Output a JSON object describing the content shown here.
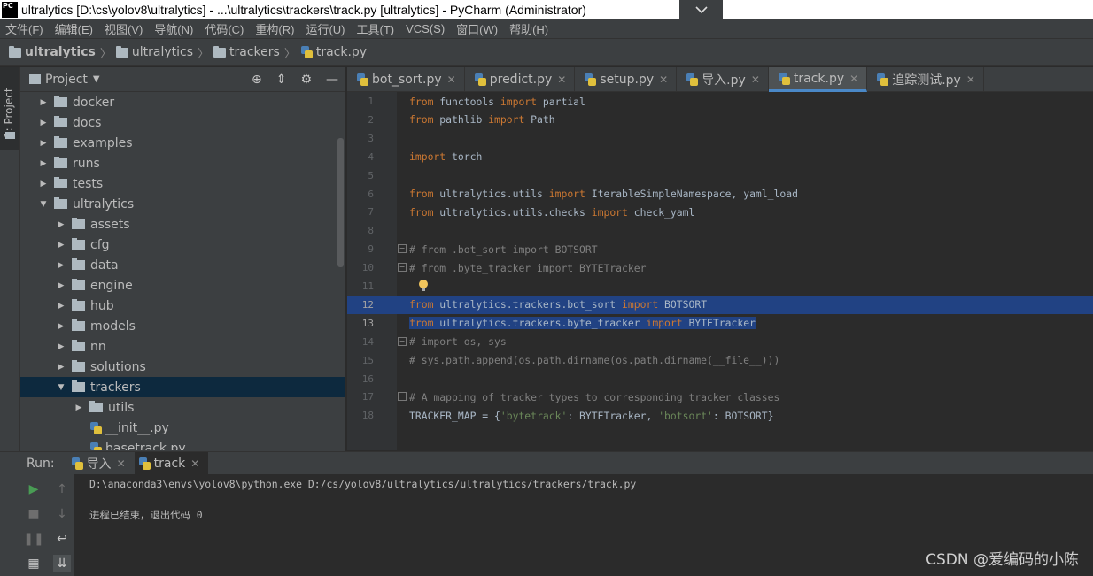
{
  "titlebar": {
    "logo": "PC",
    "title": "ultralytics [D:\\cs\\yolov8\\ultralytics] - ...\\ultralytics\\trackers\\track.py [ultralytics] - PyCharm (Administrator)"
  },
  "menu": [
    "文件(F)",
    "编辑(E)",
    "视图(V)",
    "导航(N)",
    "代码(C)",
    "重构(R)",
    "运行(U)",
    "工具(T)",
    "VCS(S)",
    "窗口(W)",
    "帮助(H)"
  ],
  "breadcrumb": [
    "ultralytics",
    "ultralytics",
    "trackers",
    "track.py"
  ],
  "toolstrip": {
    "project_label": "1: Project"
  },
  "project_panel": {
    "title": "Project",
    "tree": [
      {
        "label": "docker",
        "indent": 0,
        "expanded": false
      },
      {
        "label": "docs",
        "indent": 0,
        "expanded": false
      },
      {
        "label": "examples",
        "indent": 0,
        "expanded": false
      },
      {
        "label": "runs",
        "indent": 0,
        "expanded": false
      },
      {
        "label": "tests",
        "indent": 0,
        "expanded": false
      },
      {
        "label": "ultralytics",
        "indent": 0,
        "expanded": true
      },
      {
        "label": "assets",
        "indent": 1,
        "expanded": false
      },
      {
        "label": "cfg",
        "indent": 1,
        "expanded": false
      },
      {
        "label": "data",
        "indent": 1,
        "expanded": false
      },
      {
        "label": "engine",
        "indent": 1,
        "expanded": false
      },
      {
        "label": "hub",
        "indent": 1,
        "expanded": false
      },
      {
        "label": "models",
        "indent": 1,
        "expanded": false
      },
      {
        "label": "nn",
        "indent": 1,
        "expanded": false
      },
      {
        "label": "solutions",
        "indent": 1,
        "expanded": false
      },
      {
        "label": "trackers",
        "indent": 1,
        "expanded": true,
        "selected": true
      },
      {
        "label": "utils",
        "indent": 2,
        "expanded": false
      },
      {
        "label": "__init__.py",
        "indent": 2,
        "file": true
      },
      {
        "label": "basetrack.py",
        "indent": 2,
        "file": true
      }
    ]
  },
  "tabs": [
    {
      "label": "bot_sort.py",
      "active": false
    },
    {
      "label": "predict.py",
      "active": false
    },
    {
      "label": "setup.py",
      "active": false
    },
    {
      "label": "导入.py",
      "active": false
    },
    {
      "label": "track.py",
      "active": true
    },
    {
      "label": "追踪测试.py",
      "active": false
    }
  ],
  "code": [
    {
      "n": "1",
      "html": "<span class=\"kw\">from</span> functools <span class=\"kw\">import</span> partial"
    },
    {
      "n": "2",
      "html": "<span class=\"kw\">from</span> pathlib <span class=\"kw\">import</span> Path"
    },
    {
      "n": "3",
      "html": ""
    },
    {
      "n": "4",
      "html": "<span class=\"kw\">import</span> torch"
    },
    {
      "n": "5",
      "html": ""
    },
    {
      "n": "6",
      "html": "<span class=\"kw\">from</span> ultralytics.utils <span class=\"kw\">import</span> IterableSimpleNamespace, yaml_load"
    },
    {
      "n": "7",
      "html": "<span class=\"kw\">from</span> ultralytics.utils.checks <span class=\"kw\">import</span> check_yaml"
    },
    {
      "n": "8",
      "html": ""
    },
    {
      "n": "9",
      "html": "<span class=\"cm\"># from .bot_sort import BOTSORT</span>"
    },
    {
      "n": "10",
      "html": "<span class=\"cm\"># from .byte_tracker import BYTETracker</span>"
    },
    {
      "n": "11",
      "html": ""
    },
    {
      "n": "12",
      "html": "<span class=\"kw\">from</span> ultralytics.trackers.bot_sort <span class=\"kw\">import</span> BOTSORT"
    },
    {
      "n": "13",
      "html": "<span class=\"sel-span\"><span class=\"kw\">from</span> ultralytics.trackers.byte_tracker <span class=\"kw\">import</span> BYTETracker</span>"
    },
    {
      "n": "14",
      "html": "<span class=\"cm\"># import os, sys</span>"
    },
    {
      "n": "15",
      "html": "<span class=\"cm\"># sys.path.append(os.path.dirname(os.path.dirname(__file__)))</span>"
    },
    {
      "n": "16",
      "html": ""
    },
    {
      "n": "17",
      "html": "<span class=\"cm\"># A mapping of tracker types to corresponding tracker classes</span>"
    },
    {
      "n": "18",
      "html": "TRACKER_MAP = {<span class=\"str\">'bytetrack'</span>: BYTETracker, <span class=\"str\">'botsort'</span>: BOTSORT}"
    }
  ],
  "run": {
    "label": "Run:",
    "tabs": [
      {
        "label": "导入",
        "active": false
      },
      {
        "label": "track",
        "active": true
      }
    ],
    "console": [
      "D:\\anaconda3\\envs\\yolov8\\python.exe D:/cs/yolov8/ultralytics/ultralytics/trackers/track.py",
      "",
      "进程已结束，退出代码 0"
    ]
  },
  "watermark": "CSDN @爱编码的小陈",
  "colors": {
    "background": "#2b2b2b",
    "panel": "#3c3f41",
    "selection": "#214283",
    "keyword": "#cc7832",
    "comment": "#808080",
    "string": "#6a8759",
    "run_green": "#499c54"
  }
}
